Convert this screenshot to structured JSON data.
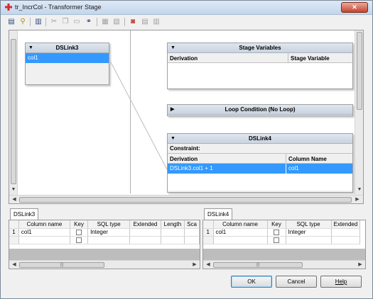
{
  "window": {
    "title": "tr_IncrCol - Transformer Stage",
    "close_symbol": "✕"
  },
  "toolbar": {
    "icons": [
      "properties-icon",
      "link-icon",
      "column-order-icon",
      "cut-icon",
      "copy-icon",
      "paste-icon",
      "find-icon",
      "load-icon",
      "save-icon",
      "show-all-icon",
      "toggle-icon",
      "autofit-icon"
    ]
  },
  "input_link": {
    "name": "DSLink3",
    "columns": [
      "col1"
    ]
  },
  "stage_variables": {
    "title": "Stage Variables",
    "col_derivation": "Derivation",
    "col_stage_variable": "Stage Variable"
  },
  "loop": {
    "title": "Loop Condition (No Loop)"
  },
  "output_link": {
    "name": "DSLink4",
    "constraint_label": "Constraint:",
    "col_derivation": "Derivation",
    "col_column_name": "Column Name",
    "rows": [
      {
        "derivation": "DSLink3.col1 + 1",
        "column_name": "col1"
      }
    ]
  },
  "left_grid": {
    "tab": "DSLink3",
    "headers": [
      "Column name",
      "Key",
      "SQL type",
      "Extended",
      "Length",
      "Sca"
    ],
    "rows": [
      {
        "num": "1",
        "name": "col1",
        "sql_type": "Integer"
      }
    ],
    "scroll_thumb": "|||"
  },
  "right_grid": {
    "tab": "DSLink4",
    "headers": [
      "Column name",
      "Key",
      "SQL type",
      "Extended"
    ],
    "rows": [
      {
        "num": "1",
        "name": "col1",
        "sql_type": "Integer"
      }
    ],
    "scroll_thumb": "|||"
  },
  "buttons": {
    "ok": "OK",
    "cancel": "Cancel",
    "help": "Help"
  }
}
